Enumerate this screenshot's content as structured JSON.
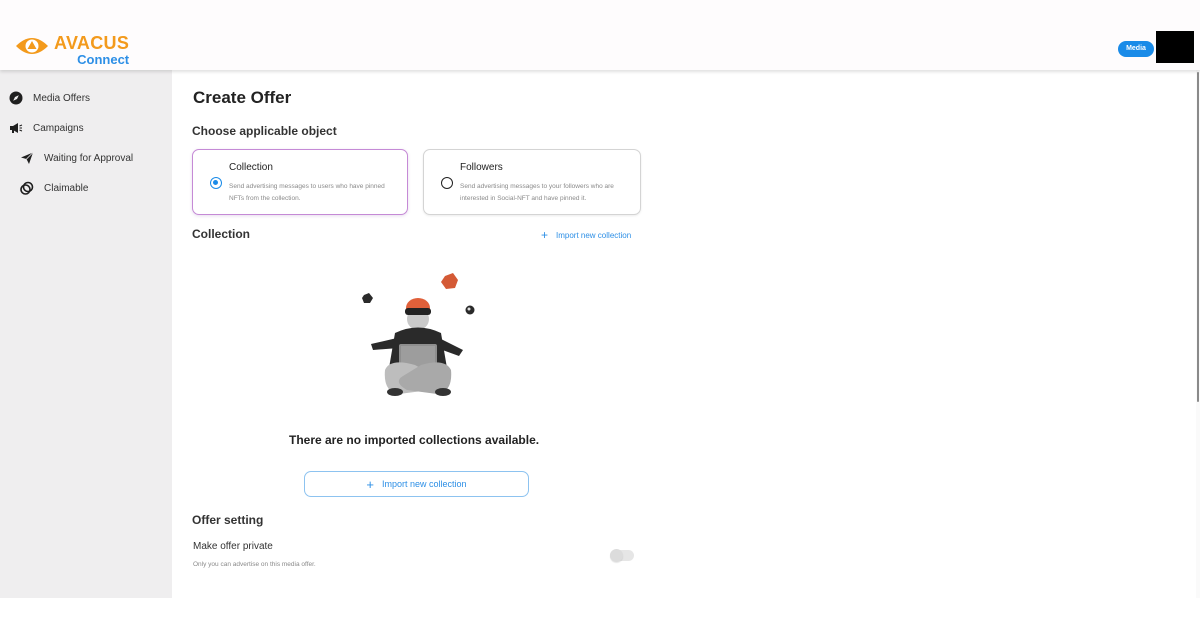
{
  "header": {
    "brand": "AVACUS",
    "brand_sub": "Connect",
    "media_badge": "Media",
    "colors": {
      "brand": "#f39a1c",
      "accent": "#2d8fe6"
    }
  },
  "sidebar": {
    "items": [
      {
        "label": "Media Offers",
        "icon": "compass-icon"
      },
      {
        "label": "Campaigns",
        "icon": "megaphone-icon"
      },
      {
        "label": "Waiting for Approval",
        "icon": "paper-plane-icon"
      },
      {
        "label": "Claimable",
        "icon": "coins-icon"
      }
    ]
  },
  "main": {
    "title": "Create Offer",
    "object_section": {
      "title": "Choose applicable object",
      "options": [
        {
          "title": "Collection",
          "description": "Send advertising messages to users who have pinned NFTs from the collection.",
          "selected": true
        },
        {
          "title": "Followers",
          "description": "Send advertising messages to your followers who are interested in Social-NFT and have pinned it.",
          "selected": false
        }
      ]
    },
    "collection_section": {
      "title": "Collection",
      "import_link": "Import new collection",
      "empty_message": "There are no imported collections available.",
      "import_button": "Import new collection"
    },
    "offer_setting": {
      "title": "Offer setting",
      "private_label": "Make offer private",
      "private_description": "Only you can advertise on this media offer.",
      "private_enabled": false
    }
  }
}
